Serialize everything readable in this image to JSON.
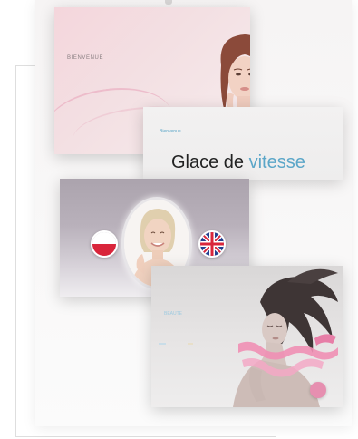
{
  "cards": {
    "bienvenue": {
      "label": "BIENVENUE"
    },
    "glace": {
      "small_label": "Bienvenue",
      "title_main": "Glace de ",
      "title_accent": "vitesse"
    },
    "language": {
      "flags": [
        {
          "name": "poland",
          "icon": "flag-poland-icon"
        },
        {
          "name": "united-kingdom",
          "icon": "flag-uk-icon"
        }
      ]
    },
    "hair": {
      "small_label": "BEAUTE"
    }
  },
  "colors": {
    "accent": "#5ba6c8",
    "pink": "#e68fb0",
    "flag_red": "#d9253b"
  }
}
